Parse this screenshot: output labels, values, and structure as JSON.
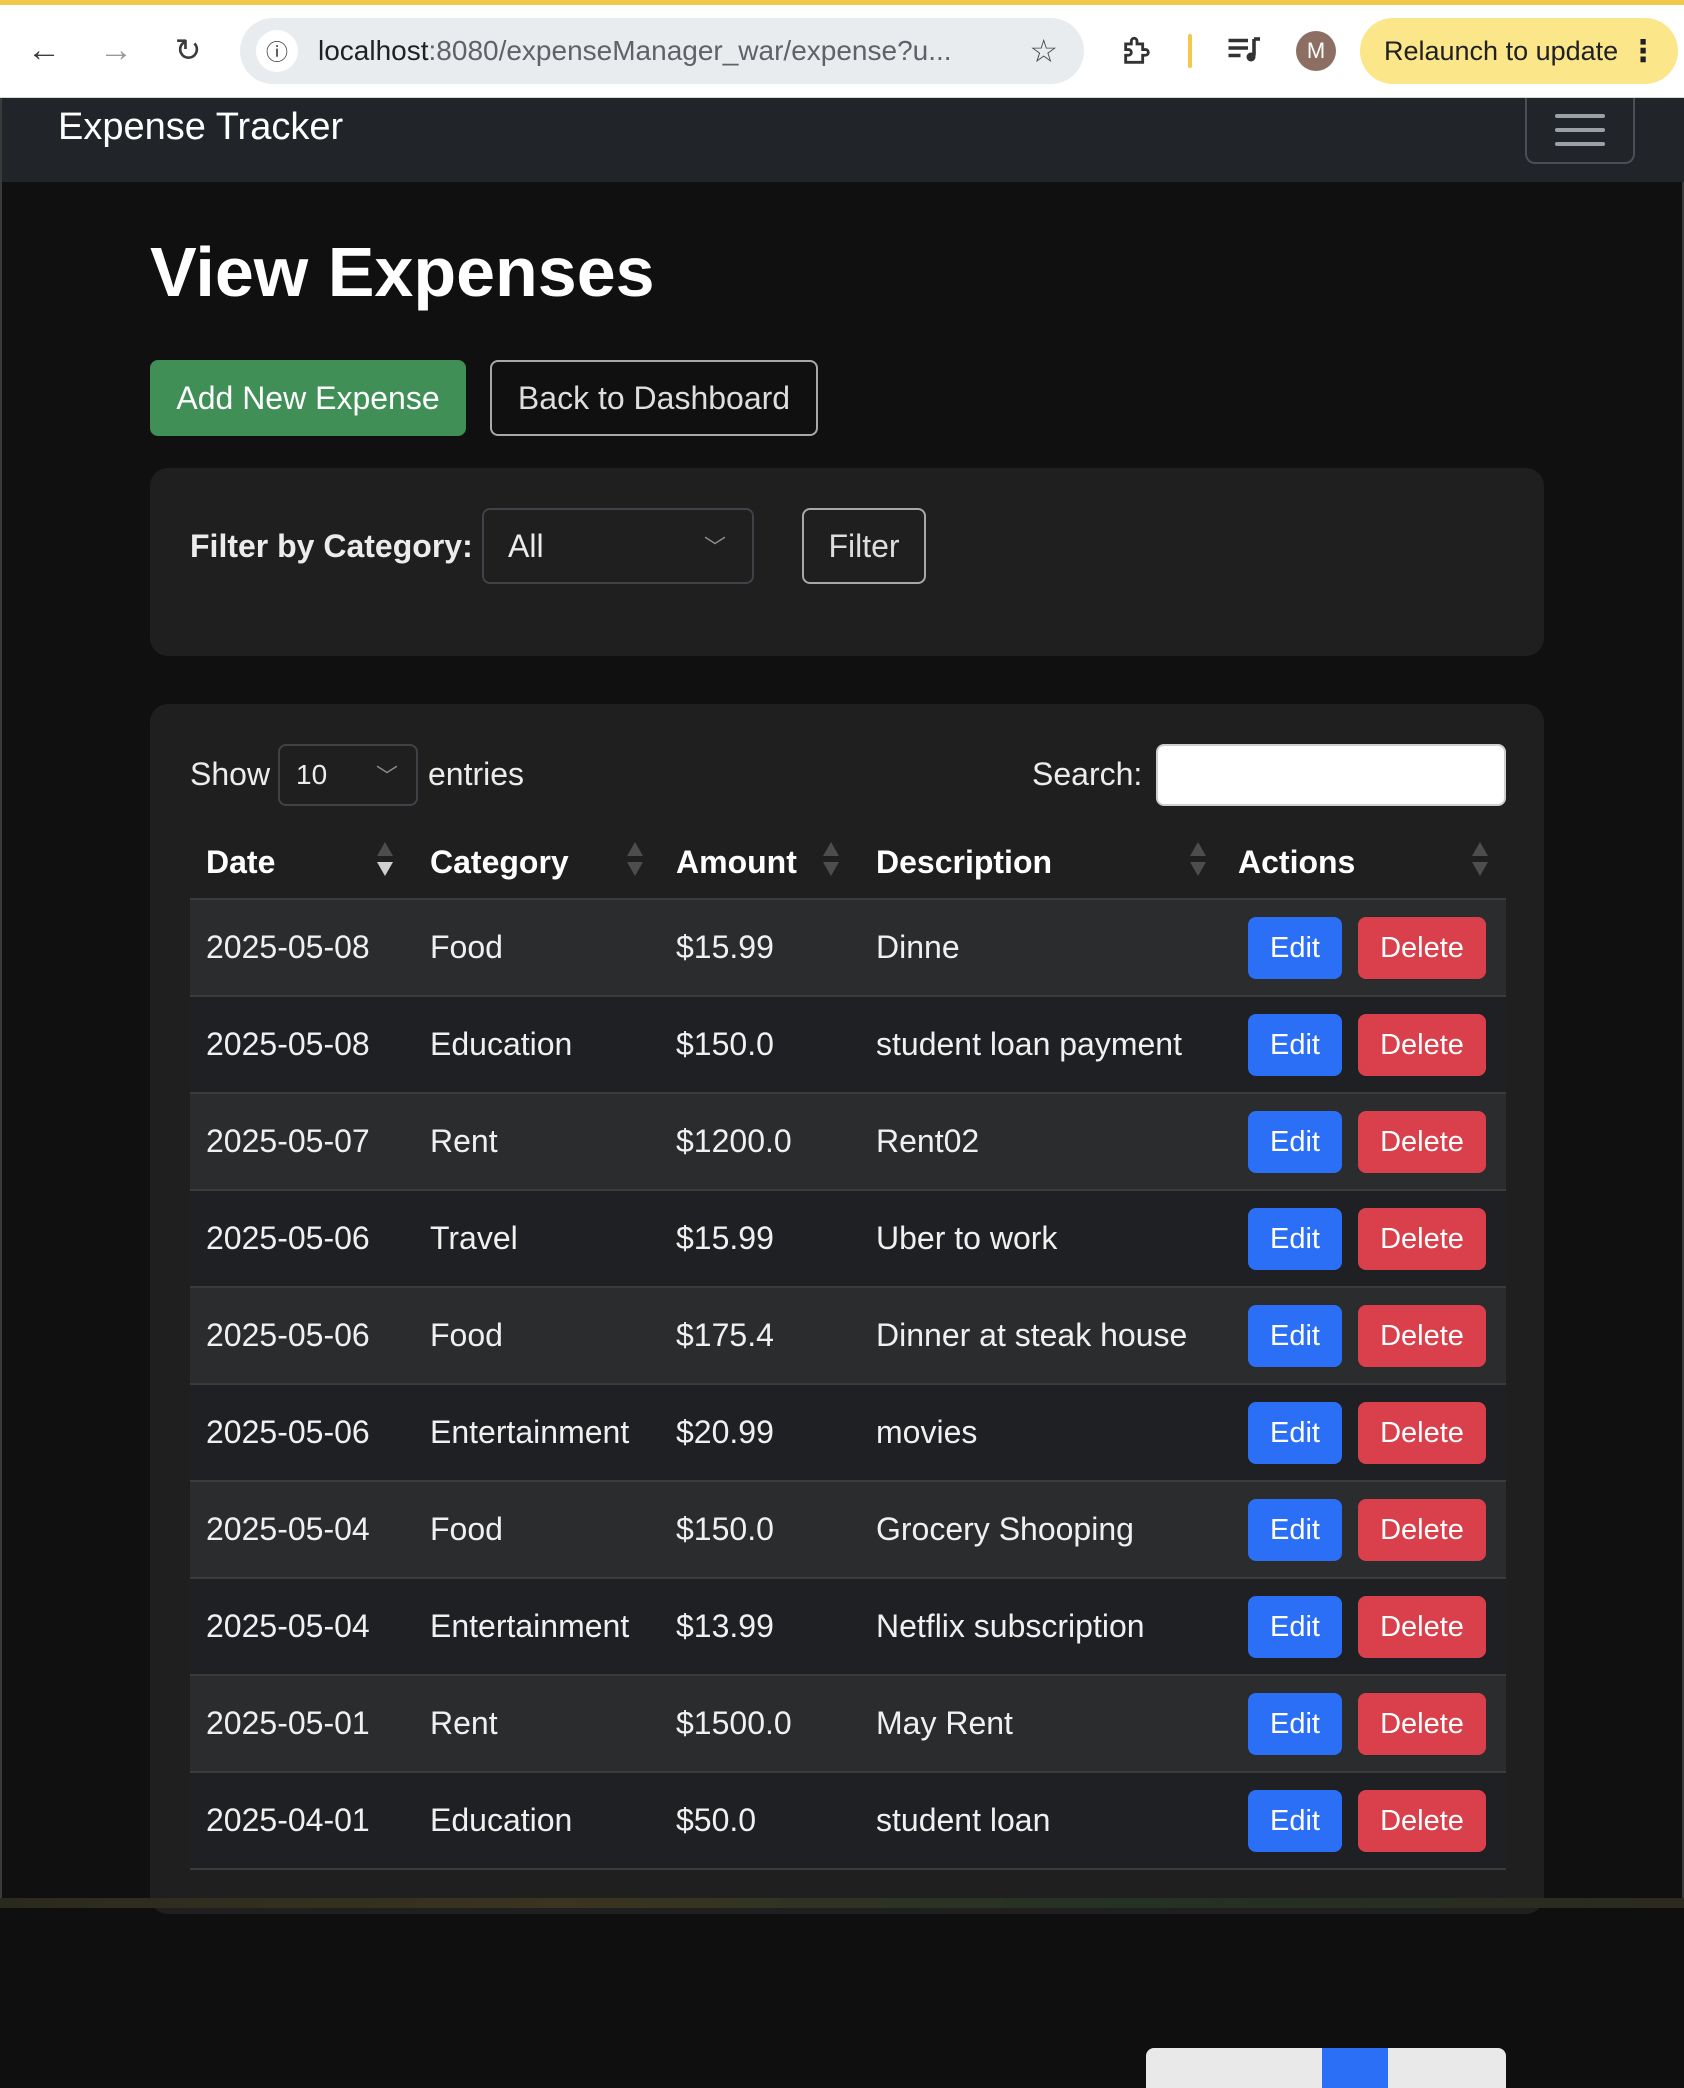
{
  "browser": {
    "url_host": "localhost",
    "url_rest": ":8080/expenseManager_war/expense?u...",
    "relaunch_label": "Relaunch to update",
    "avatar_letter": "M",
    "accent_color": "#f2c94c"
  },
  "navbar": {
    "brand": "Expense Tracker"
  },
  "page": {
    "title": "View Expenses",
    "add_button": "Add New Expense",
    "back_button": "Back to Dashboard"
  },
  "filter": {
    "label": "Filter by Category:",
    "selected": "All",
    "button": "Filter"
  },
  "table_controls": {
    "show_label": "Show",
    "entries_value": "10",
    "entries_label": "entries",
    "search_label": "Search:",
    "search_value": ""
  },
  "table": {
    "columns": [
      "Date",
      "Category",
      "Amount",
      "Description",
      "Actions"
    ],
    "sorted_column": "Date",
    "sort_direction": "descending",
    "edit_label": "Edit",
    "delete_label": "Delete",
    "rows": [
      {
        "date": "2025-05-08",
        "category": "Food",
        "amount": "$15.99",
        "description": "Dinne"
      },
      {
        "date": "2025-05-08",
        "category": "Education",
        "amount": "$150.0",
        "description": "student loan payment"
      },
      {
        "date": "2025-05-07",
        "category": "Rent",
        "amount": "$1200.0",
        "description": "Rent02"
      },
      {
        "date": "2025-05-06",
        "category": "Travel",
        "amount": "$15.99",
        "description": "Uber to work"
      },
      {
        "date": "2025-05-06",
        "category": "Food",
        "amount": "$175.4",
        "description": "Dinner at steak house"
      },
      {
        "date": "2025-05-06",
        "category": "Entertainment",
        "amount": "$20.99",
        "description": "movies"
      },
      {
        "date": "2025-05-04",
        "category": "Food",
        "amount": "$150.0",
        "description": "Grocery Shooping"
      },
      {
        "date": "2025-05-04",
        "category": "Entertainment",
        "amount": "$13.99",
        "description": "Netflix subscription"
      },
      {
        "date": "2025-05-01",
        "category": "Rent",
        "amount": "$1500.0",
        "description": "May Rent"
      },
      {
        "date": "2025-04-01",
        "category": "Education",
        "amount": "$50.0",
        "description": "student loan"
      }
    ]
  },
  "colors": {
    "success": "#3f8f56",
    "primary": "#2a6ff5",
    "danger": "#d9404b",
    "navbar": "#212529"
  }
}
